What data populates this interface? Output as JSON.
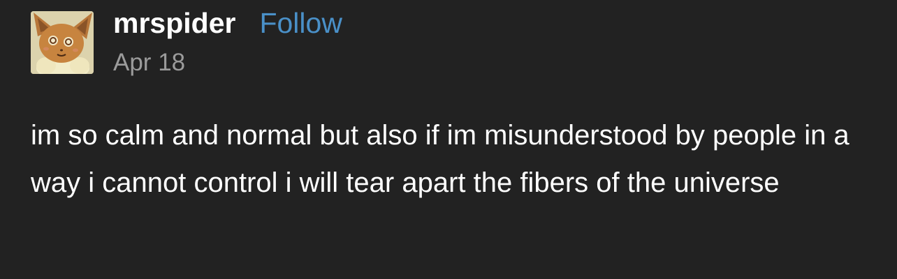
{
  "post": {
    "username": "mrspider",
    "follow_label": "Follow",
    "date": "Apr 18",
    "body": "im so calm and normal but also if im misunderstood by people in a way i cannot control i will tear apart the fibers of the universe",
    "avatar_icon": "eevee-avatar-icon"
  },
  "colors": {
    "background": "#222222",
    "text": "#ffffff",
    "follow_accent": "#4a90c8",
    "date": "#9b9b9b"
  }
}
